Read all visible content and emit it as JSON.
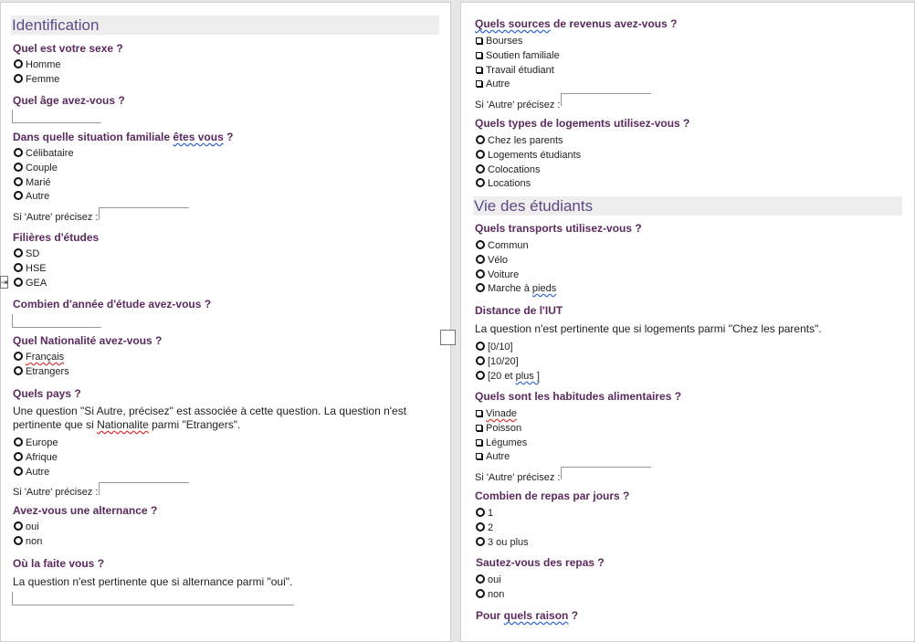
{
  "left": {
    "section_identification": "Identification",
    "q_sexe": "Quel est votre sexe ?",
    "opt_homme": "Homme",
    "opt_femme": "Femme",
    "q_age": "Quel âge avez-vous ?",
    "q_situation_a": "Dans quelle situation familiale ",
    "q_situation_b": "êtes vous",
    "q_situation_c": " ?",
    "opt_celibataire": "Célibataire",
    "opt_couple": "Couple",
    "opt_marie": "Marié",
    "opt_autre_1": "Autre",
    "precise_1": "Si 'Autre' précisez :",
    "q_filieres": "Filières d'études",
    "opt_sd": "SD",
    "opt_hse": "HSE",
    "opt_gea": "GEA",
    "q_annee": "Combien d'année d'étude avez-vous ?",
    "q_nationalite": "Quel Nationalité avez-vous ?",
    "opt_francais": "Français",
    "opt_etrangers": "Etrangers",
    "q_pays": "Quels pays ?",
    "note_pays_a": "Une question \"Si Autre, précisez\" est associée à cette question. La question n'est",
    "note_pays_b": "pertinente que si ",
    "note_pays_c": "Nationalite",
    "note_pays_d": " parmi \"Etrangers\".",
    "opt_europe": "Europe",
    "opt_afrique": "Afrique",
    "opt_autre_2": "Autre",
    "precise_2": "Si 'Autre' précisez :",
    "q_alternance": "Avez-vous une alternance ?",
    "opt_oui_1": "oui",
    "opt_non_1": "non",
    "q_ou": "Où la faite vous ?",
    "note_ou": "La question n'est pertinente que si alternance parmi \"oui\"."
  },
  "right": {
    "q_revenus_a": "Quels sources",
    "q_revenus_b": " de revenus avez-vous ?",
    "opt_bourses": "Bourses",
    "opt_soutien": "Soutien familiale",
    "opt_travail": "Travail étudiant",
    "opt_autre_3": "Autre",
    "precise_3": "Si 'Autre' précisez :",
    "q_logements": "Quels types de logements utilisez-vous ?",
    "opt_parents": "Chez les parents",
    "opt_log_etu": "Logements étudiants",
    "opt_colocations": "Colocations",
    "opt_locations": "Locations",
    "section_vie": "Vie des étudiants",
    "q_transports": "Quels transports utilisez-vous ?",
    "opt_commun": "Commun",
    "opt_velo": "Vélo",
    "opt_voiture": "Voiture",
    "opt_marche_a": "Marche à ",
    "opt_marche_b": "pieds",
    "q_distance": "Distance de l'IUT",
    "note_distance": "La question n'est pertinente que si logements parmi \"Chez les parents\".",
    "opt_d1": "[0/10]",
    "opt_d2": "[10/20]",
    "opt_d3_a": "[20 et ",
    "opt_d3_b": "plus ]",
    "q_habitudes": "Quels sont les habitudes alimentaires ?",
    "opt_viande": "Vinade",
    "opt_poisson": "Poisson",
    "opt_legumes": "Légumes",
    "opt_autre_4": "Autre",
    "precise_4": "Si 'Autre' précisez :",
    "q_repas": "Combien de repas par jours ?",
    "opt_r1": "1",
    "opt_r2": "2",
    "opt_r3": "3 ou plus",
    "q_sautez": "Sautez-vous des repas ?",
    "opt_oui_2": "oui",
    "opt_non_2": "non",
    "q_raison_a": "Pour ",
    "q_raison_b": "quels raison",
    "q_raison_c": " ?"
  },
  "icons": {
    "move": "move-arrows-icon",
    "radio": "radio-circle-icon",
    "checkbox": "checkbox-square-icon"
  },
  "colors": {
    "question": "#5b2a5e",
    "section": "#5a4a85",
    "section_bg": "#eeeeee"
  }
}
